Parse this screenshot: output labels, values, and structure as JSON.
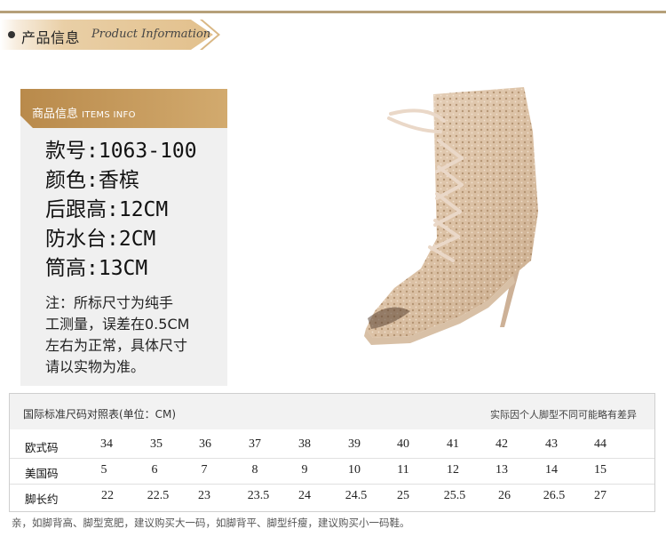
{
  "header": {
    "title": "产品信息",
    "subtitle": "Product Information"
  },
  "items_info": {
    "head_cn": "商品信息",
    "head_en": "ITEMS INFO",
    "lines": [
      "款号:1063-100",
      "颜色:香槟",
      "后跟高:12CM",
      "防水台:2CM",
      "筒高:13CM"
    ],
    "note_lines": [
      "注：所标尺寸为纯手",
      "工测量，误差在0.5CM",
      "左右为正常，具体尺寸",
      "请以实物为准。"
    ]
  },
  "size_table": {
    "title": "国际标准尺码对照表(单位：CM)",
    "tip": "实际因个人脚型不同可能略有差异",
    "rows": [
      {
        "label": "欧式码",
        "values": [
          "34",
          "35",
          "36",
          "37",
          "38",
          "39",
          "40",
          "41",
          "42",
          "43",
          "44"
        ]
      },
      {
        "label": "美国码",
        "values": [
          "5",
          "6",
          "7",
          "8",
          "9",
          "10",
          "11",
          "12",
          "13",
          "14",
          "15"
        ]
      },
      {
        "label": "脚长约",
        "values": [
          "22",
          "22.5",
          "23",
          "23.5",
          "24",
          "24.5",
          "25",
          "25.5",
          "26",
          "26.5",
          "27"
        ]
      }
    ]
  },
  "bottom_note": "亲，如脚背高、脚型宽肥，建议购买大一码，如脚背平、脚型纤瘦，建议购买小一码鞋。",
  "colors": {
    "accent_gold": "#c49a5a",
    "band_light": "#f5ebdc"
  },
  "icons": {
    "bullet": "dot-icon"
  }
}
